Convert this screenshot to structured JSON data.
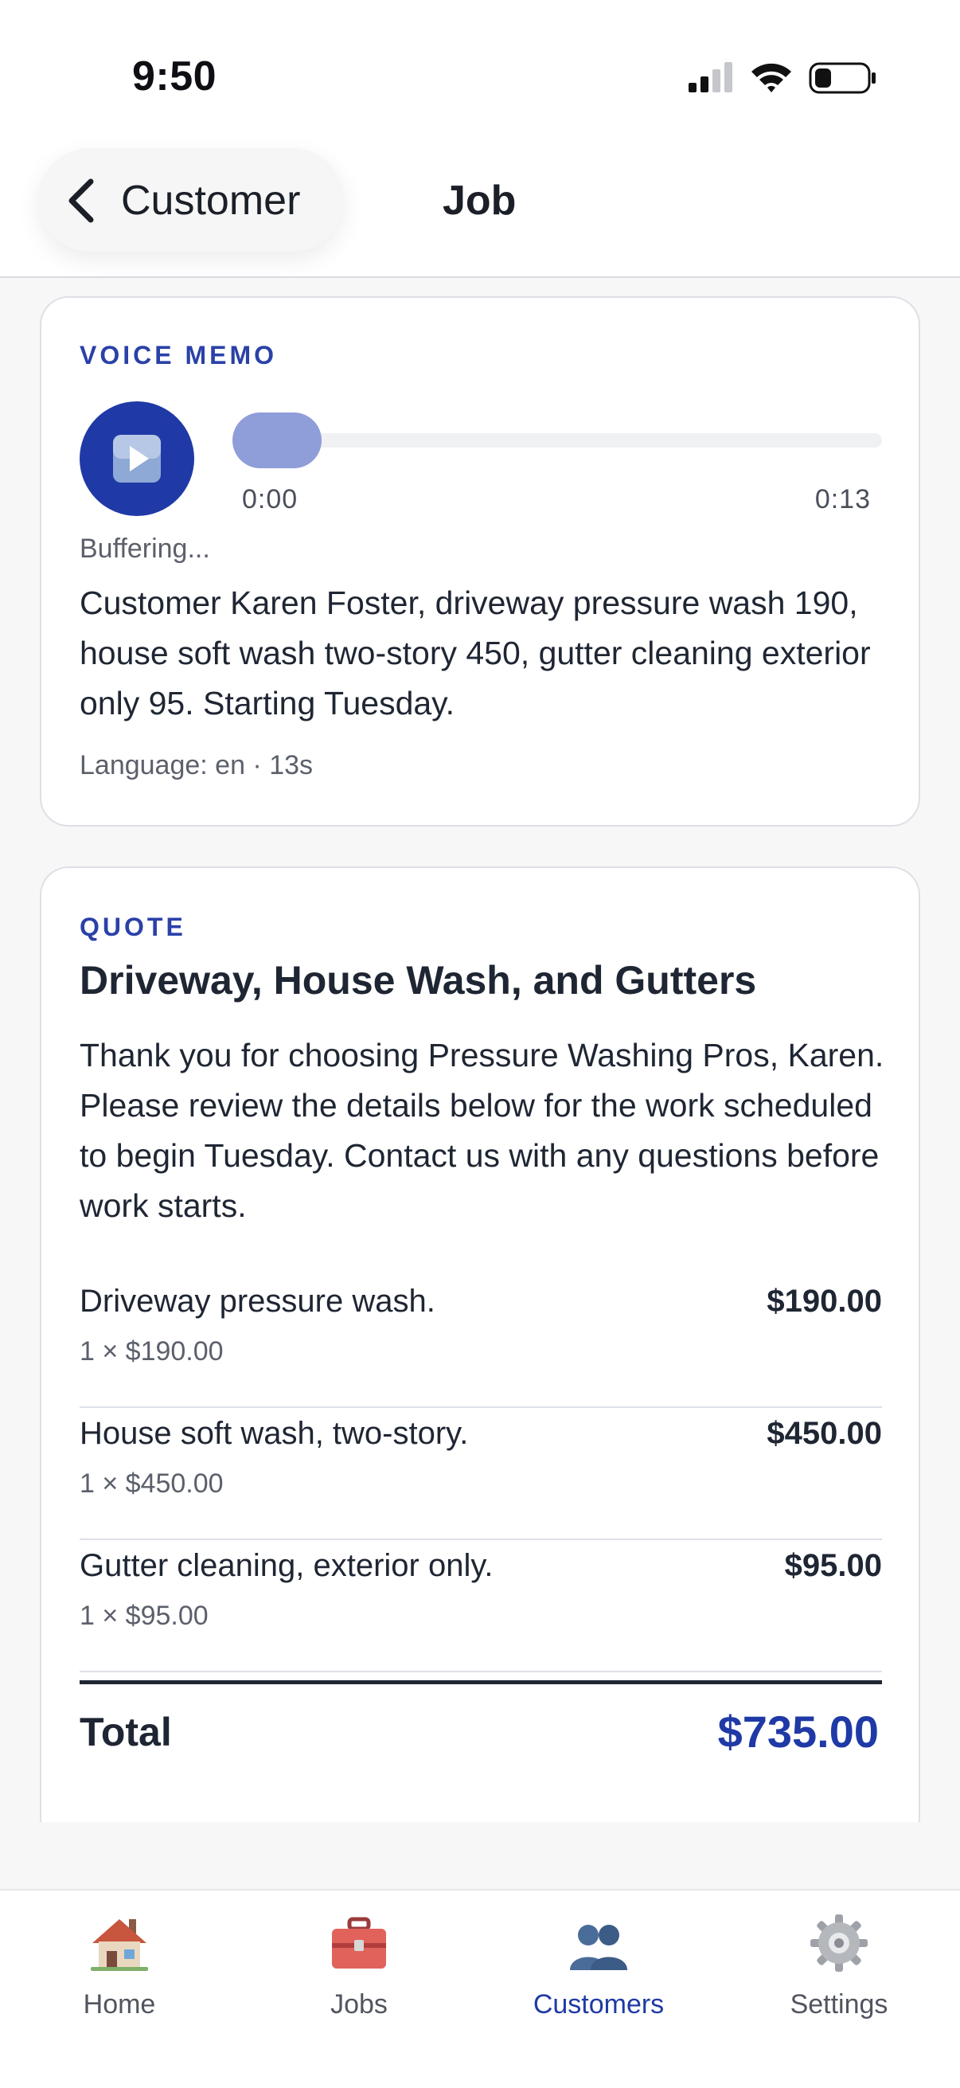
{
  "status_bar": {
    "time": "9:50"
  },
  "header": {
    "back_label": "Customer",
    "title": "Job"
  },
  "voice_memo": {
    "section_label": "VOICE MEMO",
    "current_time": "0:00",
    "duration": "0:13",
    "progress": 0,
    "status": "Buffering...",
    "transcript": "Customer Karen Foster, driveway pressure wash 190, house soft wash two-story 450, gutter cleaning exterior only 95. Starting Tuesday.",
    "meta": "Language: en · 13s"
  },
  "quote": {
    "section_label": "QUOTE",
    "title": "Driveway, House Wash, and Gutters",
    "intro": "Thank you for choosing Pressure Washing Pros, Karen. Please review the details below for the work scheduled to begin Tuesday. Contact us with any questions before work starts.",
    "items": [
      {
        "name": "Driveway pressure wash.",
        "qty_price": "1 × $190.00",
        "amount": "$190.00"
      },
      {
        "name": "House soft wash, two-story.",
        "qty_price": "1 × $450.00",
        "amount": "$450.00"
      },
      {
        "name": "Gutter cleaning, exterior only.",
        "qty_price": "1 × $95.00",
        "amount": "$95.00"
      }
    ],
    "total_label": "Total",
    "total_value": "$735.00"
  },
  "tabbar": {
    "tabs": [
      {
        "label": "Home",
        "icon": "house-icon"
      },
      {
        "label": "Jobs",
        "icon": "toolbox-icon"
      },
      {
        "label": "Customers",
        "icon": "people-icon",
        "active": true
      },
      {
        "label": "Settings",
        "icon": "gear-icon"
      }
    ]
  },
  "colors": {
    "accent": "#1f3aa6",
    "accent_light": "#8f9dd8",
    "text": "#1f2633",
    "muted": "#5b606b"
  }
}
